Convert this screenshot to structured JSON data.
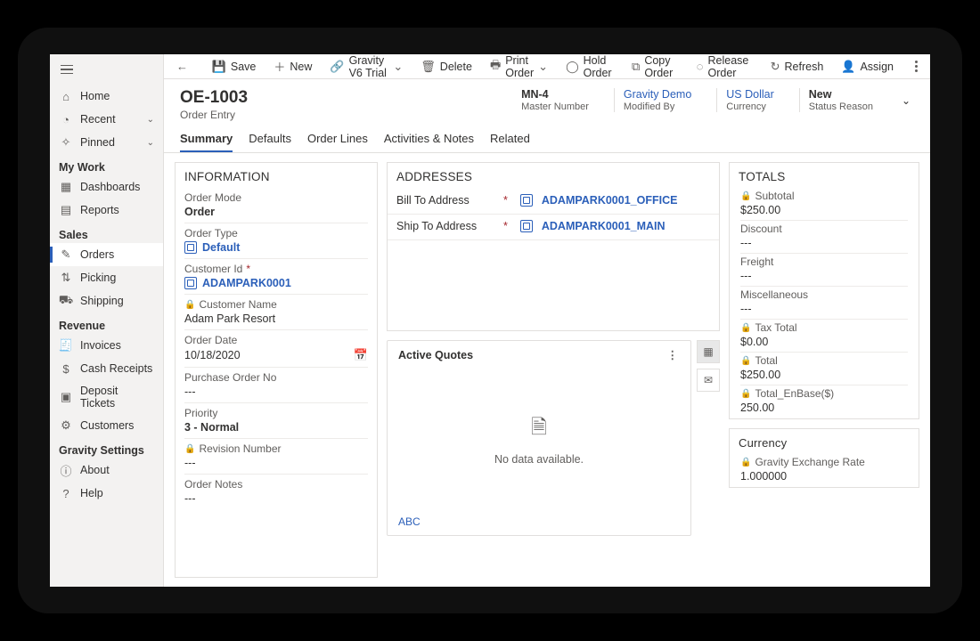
{
  "sidebar": {
    "home": "Home",
    "recent": "Recent",
    "pinned": "Pinned",
    "sections": {
      "mywork": {
        "title": "My Work",
        "items": [
          "Dashboards",
          "Reports"
        ]
      },
      "sales": {
        "title": "Sales",
        "items": [
          "Orders",
          "Picking",
          "Shipping"
        ]
      },
      "revenue": {
        "title": "Revenue",
        "items": [
          "Invoices",
          "Cash Receipts",
          "Deposit Tickets",
          "Customers"
        ]
      },
      "settings": {
        "title": "Gravity Settings",
        "items": [
          "About",
          "Help"
        ]
      }
    }
  },
  "cmdbar": {
    "save": "Save",
    "new": "New",
    "trial": "Gravity V6 Trial",
    "delete": "Delete",
    "print": "Print Order",
    "hold": "Hold Order",
    "copy": "Copy Order",
    "release": "Release Order",
    "refresh": "Refresh",
    "assign": "Assign"
  },
  "header": {
    "title": "OE-1003",
    "subtitle": "Order Entry",
    "master": {
      "value": "MN-4",
      "label": "Master Number"
    },
    "modified": {
      "value": "Gravity Demo",
      "label": "Modified By"
    },
    "currency": {
      "value": "US Dollar",
      "label": "Currency"
    },
    "status": {
      "value": "New",
      "label": "Status Reason"
    }
  },
  "tabs": [
    "Summary",
    "Defaults",
    "Order Lines",
    "Activities & Notes",
    "Related"
  ],
  "info": {
    "title": "INFORMATION",
    "order_mode": {
      "label": "Order Mode",
      "value": "Order"
    },
    "order_type": {
      "label": "Order Type",
      "value": "Default"
    },
    "customer_id": {
      "label": "Customer Id",
      "value": "ADAMPARK0001"
    },
    "customer_name": {
      "label": "Customer Name",
      "value": "Adam Park Resort"
    },
    "order_date": {
      "label": "Order Date",
      "value": "10/18/2020"
    },
    "po": {
      "label": "Purchase Order No",
      "value": "---"
    },
    "priority": {
      "label": "Priority",
      "value": "3 - Normal"
    },
    "revision": {
      "label": "Revision Number",
      "value": "---"
    },
    "notes": {
      "label": "Order Notes",
      "value": "---"
    }
  },
  "addresses": {
    "title": "ADDRESSES",
    "bill": {
      "label": "Bill To Address",
      "value": "ADAMPARK0001_OFFICE"
    },
    "ship": {
      "label": "Ship To Address",
      "value": "ADAMPARK0001_MAIN"
    }
  },
  "quotes": {
    "title": "Active Quotes",
    "empty": "No data available.",
    "abc": "ABC"
  },
  "totals": {
    "title": "TOTALS",
    "subtotal": {
      "label": "Subtotal",
      "value": "$250.00"
    },
    "discount": {
      "label": "Discount",
      "value": "---"
    },
    "freight": {
      "label": "Freight",
      "value": "---"
    },
    "misc": {
      "label": "Miscellaneous",
      "value": "---"
    },
    "tax": {
      "label": "Tax Total",
      "value": "$0.00"
    },
    "total": {
      "label": "Total",
      "value": "$250.00"
    },
    "enbase": {
      "label": "Total_EnBase($)",
      "value": "250.00"
    }
  },
  "currency_card": {
    "title": "Currency",
    "rate": {
      "label": "Gravity Exchange Rate",
      "value": "1.000000"
    }
  }
}
